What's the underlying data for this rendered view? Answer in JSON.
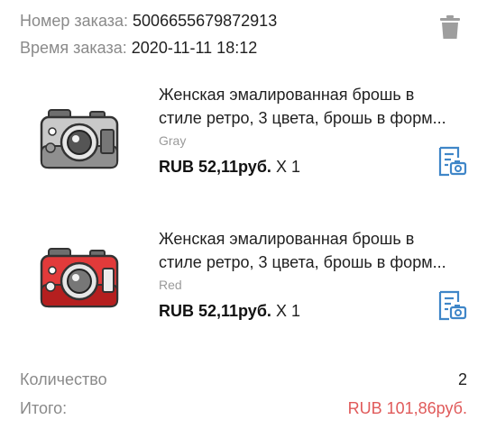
{
  "order": {
    "number_label": "Номер заказа:",
    "number_value": "5006655679872913",
    "time_label": "Время заказа:",
    "time_value": "2020-11-11 18:12"
  },
  "items": [
    {
      "title_line1": "Женская эмалированная брошь в",
      "title_line2": "стиле ретро, 3 цвета, брошь в форм...",
      "variant": "Gray",
      "price": "RUB 52,11руб.",
      "quantity": "X 1"
    },
    {
      "title_line1": "Женская эмалированная брошь в",
      "title_line2": "стиле ретро, 3 цвета, брошь в форм...",
      "variant": "Red",
      "price": "RUB 52,11руб.",
      "quantity": "X 1"
    }
  ],
  "summary": {
    "quantity_label": "Количество",
    "quantity_value": "2",
    "total_label": "Итого:",
    "total_value": "RUB 101,86руб."
  },
  "icons": {
    "delete": "trash-icon",
    "review": "document-camera-icon"
  },
  "colors": {
    "total_accent": "#e05a5a",
    "icon_blue": "#3f86c8",
    "icon_gray": "#9e9e9e"
  }
}
